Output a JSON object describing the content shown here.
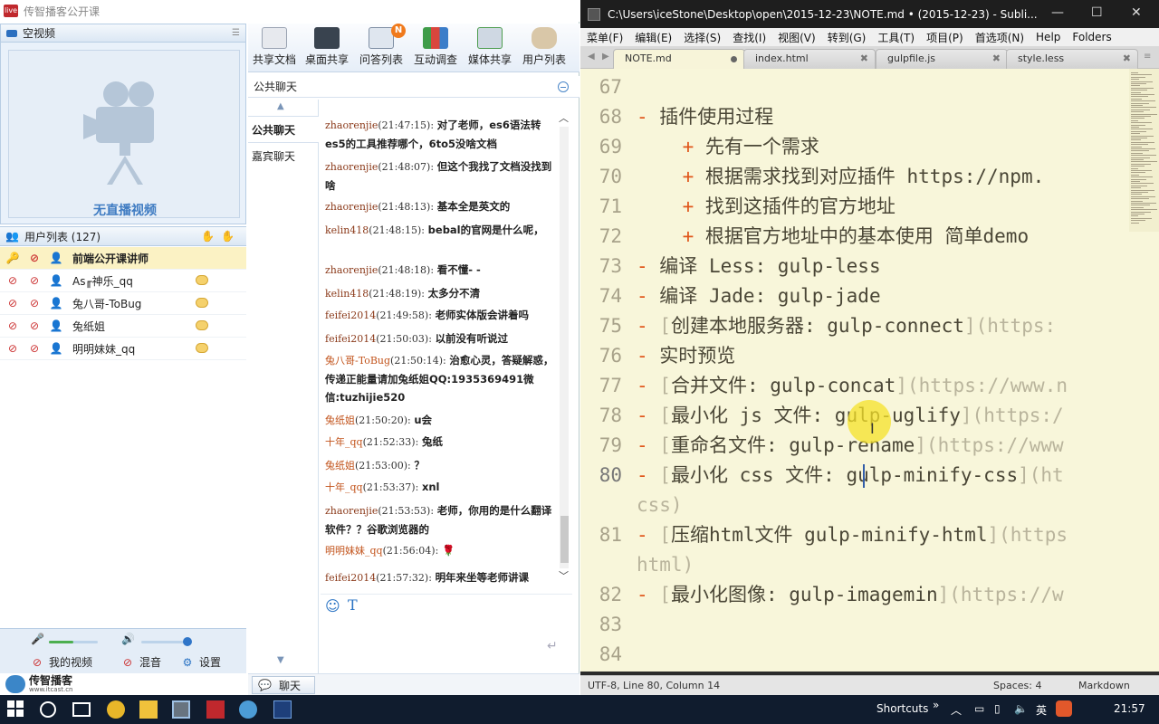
{
  "left_app": {
    "title": "传智播客公开课",
    "video_panel": {
      "title": "空视频",
      "no_video": "无直播视频"
    },
    "userlist": {
      "title": "用户列表 (127)",
      "users": [
        {
          "name": "前端公开课讲师",
          "role": "teacher"
        },
        {
          "name": "As╓神乐_qq",
          "role": "user"
        },
        {
          "name": "兔八哥-ToBug",
          "role": "user"
        },
        {
          "name": "兔纸姐",
          "role": "user"
        },
        {
          "name": "明明妹妹_qq",
          "role": "user"
        }
      ]
    },
    "controls": {
      "my_video": "我的视频",
      "mix": "混音",
      "settings": "设置",
      "mic_level": 0.5,
      "volume_level": 1.0
    },
    "brand": {
      "name": "传智播客",
      "sub": "www.itcast.cn"
    },
    "toolbar": [
      "共享文档",
      "桌面共享",
      "问答列表",
      "互动调查",
      "媒体共享",
      "用户列表"
    ],
    "toolbar_badge": "N",
    "chat": {
      "header": "公共聊天",
      "tabs": [
        "公共聊天",
        "嘉宾聊天"
      ],
      "messages": [
        {
          "nick": "zhaorenjie",
          "time": "(21:47:15):",
          "text": "对了老师，es6语法转es5的工具推荐哪个，6to5没啥文档",
          "color": "#8b3a1a"
        },
        {
          "nick": "zhaorenjie",
          "time": "(21:48:07):",
          "text": "但这个我找了文档没找到啥",
          "color": "#8b3a1a"
        },
        {
          "nick": "zhaorenjie",
          "time": "(21:48:13):",
          "text": "基本全是英文的",
          "color": "#8b3a1a"
        },
        {
          "nick": "kelin418",
          "time": "(21:48:15):",
          "text": "bebal的官网是什么呢，",
          "color": "#8b3a1a"
        },
        {
          "nick": "zhaorenjie",
          "time": "(21:48:18):",
          "text": "看不懂- -",
          "color": "#8b3a1a"
        },
        {
          "nick": "kelin418",
          "time": "(21:48:19):",
          "text": "太多分不清",
          "color": "#8b3a1a"
        },
        {
          "nick": "feifei2014",
          "time": "(21:49:58):",
          "text": "老师实体版会讲着吗",
          "color": "#8b3a1a"
        },
        {
          "nick": "feifei2014",
          "time": "(21:50:03):",
          "text": "以前没有听说过",
          "color": "#8b3a1a"
        },
        {
          "nick": "兔八哥-ToBug",
          "time": "(21:50:14):",
          "text": "治愈心灵，答疑解惑，传递正能量请加兔纸姐QQ:1935369491微信:tuzhijie520",
          "color": "#c2531b"
        },
        {
          "nick": "兔纸姐",
          "time": "(21:50:20):",
          "text": "u会",
          "color": "#c2531b"
        },
        {
          "nick": "十年_qq",
          "time": "(21:52:33):",
          "text": "兔纸",
          "color": "#c2531b"
        },
        {
          "nick": "兔纸姐",
          "time": "(21:53:00):",
          "text": "？",
          "color": "#c2531b"
        },
        {
          "nick": "十年_qq",
          "time": "(21:53:37):",
          "text": "xnl",
          "color": "#c2531b"
        },
        {
          "nick": "zhaorenjie",
          "time": "(21:53:53):",
          "text": "老师，你用的是什么翻译软件？？谷歌浏览器的",
          "color": "#8b3a1a"
        },
        {
          "nick": "明明妹妹_qq",
          "time": "(21:56:04):",
          "text": "🌹",
          "color": "#c2531b"
        },
        {
          "nick": "feifei2014",
          "time": "(21:57:32):",
          "text": "明年来坐等老师讲课",
          "color": "#8b3a1a"
        }
      ],
      "footer_button": "聊天"
    }
  },
  "sublime": {
    "title": "C:\\Users\\iceStone\\Desktop\\open\\2015-12-23\\NOTE.md • (2015-12-23) - Subli...",
    "menu": [
      "菜单(F)",
      "编辑(E)",
      "选择(S)",
      "查找(I)",
      "视图(V)",
      "转到(G)",
      "工具(T)",
      "项目(P)",
      "首选项(N)",
      "Help",
      "Folders"
    ],
    "tabs": [
      "NOTE.md",
      "index.html",
      "gulpfile.js",
      "style.less"
    ],
    "lines": [
      {
        "n": "67",
        "parts": []
      },
      {
        "n": "68",
        "parts": [
          [
            "c-dash",
            "- "
          ],
          [
            "c-text",
            "插件使用过程"
          ]
        ]
      },
      {
        "n": "69",
        "parts": [
          [
            "c-text",
            "    "
          ],
          [
            "c-plus",
            "+ "
          ],
          [
            "c-text",
            "先有一个需求"
          ]
        ]
      },
      {
        "n": "70",
        "parts": [
          [
            "c-text",
            "    "
          ],
          [
            "c-plus",
            "+ "
          ],
          [
            "c-text",
            "根据需求找到对应插件 https://npm."
          ]
        ]
      },
      {
        "n": "71",
        "parts": [
          [
            "c-text",
            "    "
          ],
          [
            "c-plus",
            "+ "
          ],
          [
            "c-text",
            "找到这插件的官方地址"
          ]
        ]
      },
      {
        "n": "72",
        "parts": [
          [
            "c-text",
            "    "
          ],
          [
            "c-plus",
            "+ "
          ],
          [
            "c-text",
            "根据官方地址中的基本使用 简单demo"
          ]
        ]
      },
      {
        "n": "73",
        "parts": [
          [
            "c-dash",
            "- "
          ],
          [
            "c-text",
            "编译 Less: gulp-less"
          ]
        ]
      },
      {
        "n": "74",
        "parts": [
          [
            "c-dash",
            "- "
          ],
          [
            "c-text",
            "编译 Jade: gulp-jade"
          ]
        ]
      },
      {
        "n": "75",
        "parts": [
          [
            "c-dash",
            "- "
          ],
          [
            "c-brk",
            "["
          ],
          [
            "c-text",
            "创建本地服务器: gulp-connect"
          ],
          [
            "c-brk",
            "]"
          ],
          [
            "c-url",
            "(https:"
          ]
        ]
      },
      {
        "n": "76",
        "parts": [
          [
            "c-dash",
            "- "
          ],
          [
            "c-text",
            "实时预览"
          ]
        ]
      },
      {
        "n": "77",
        "parts": [
          [
            "c-dash",
            "- "
          ],
          [
            "c-brk",
            "["
          ],
          [
            "c-text",
            "合并文件: gulp-concat"
          ],
          [
            "c-brk",
            "]"
          ],
          [
            "c-url",
            "(https://www.n"
          ]
        ]
      },
      {
        "n": "78",
        "parts": [
          [
            "c-dash",
            "- "
          ],
          [
            "c-brk",
            "["
          ],
          [
            "c-text",
            "最小化 js 文件: gulp-uglify"
          ],
          [
            "c-brk",
            "]"
          ],
          [
            "c-url",
            "(https:/"
          ]
        ]
      },
      {
        "n": "79",
        "parts": [
          [
            "c-dash",
            "- "
          ],
          [
            "c-brk",
            "["
          ],
          [
            "c-text",
            "重命名文件: gulp-rename"
          ],
          [
            "c-brk",
            "]"
          ],
          [
            "c-url",
            "(https://www"
          ]
        ]
      },
      {
        "n": "80",
        "parts": [
          [
            "c-dash",
            "- "
          ],
          [
            "c-brk",
            "["
          ],
          [
            "c-text",
            "最小化 css 文件: gulp-minify-css"
          ],
          [
            "c-brk",
            "]"
          ],
          [
            "c-url",
            "(ht"
          ]
        ],
        "cur": true
      },
      {
        "n": "",
        "parts": [
          [
            "c-url",
            "css)"
          ]
        ]
      },
      {
        "n": "81",
        "parts": [
          [
            "c-dash",
            "- "
          ],
          [
            "c-brk",
            "["
          ],
          [
            "c-text",
            "压缩html文件 gulp-minify-html"
          ],
          [
            "c-brk",
            "]"
          ],
          [
            "c-url",
            "(https"
          ]
        ]
      },
      {
        "n": "",
        "parts": [
          [
            "c-url",
            "html)"
          ]
        ]
      },
      {
        "n": "82",
        "parts": [
          [
            "c-dash",
            "- "
          ],
          [
            "c-brk",
            "["
          ],
          [
            "c-text",
            "最小化图像: gulp-imagemin"
          ],
          [
            "c-brk",
            "]"
          ],
          [
            "c-url",
            "(https://w"
          ]
        ]
      },
      {
        "n": "83",
        "parts": []
      },
      {
        "n": "84",
        "parts": []
      }
    ],
    "status": {
      "left": "UTF-8, Line 80, Column 14",
      "spaces": "Spaces: 4",
      "syntax": "Markdown"
    }
  },
  "taskbar": {
    "shortcuts": "Shortcuts",
    "ime": "英",
    "time": "21:57"
  }
}
